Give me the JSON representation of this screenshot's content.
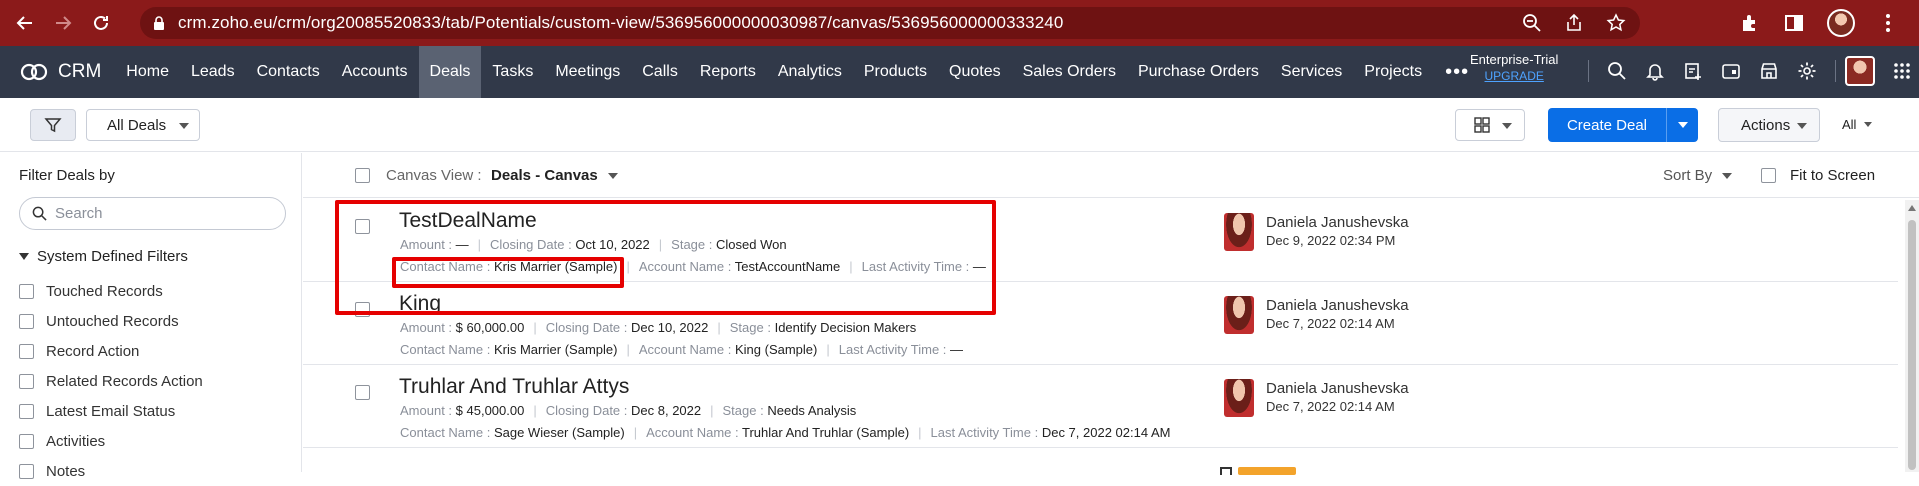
{
  "browser": {
    "url": "crm.zoho.eu/crm/org20085520833/tab/Potentials/custom-view/536956000000030987/canvas/536956000000333240"
  },
  "topnav": {
    "brand": "CRM",
    "tabs": [
      {
        "label": "Home"
      },
      {
        "label": "Leads"
      },
      {
        "label": "Contacts"
      },
      {
        "label": "Accounts"
      },
      {
        "label": "Deals",
        "active": true
      },
      {
        "label": "Tasks"
      },
      {
        "label": "Meetings"
      },
      {
        "label": "Calls"
      },
      {
        "label": "Reports"
      },
      {
        "label": "Analytics"
      },
      {
        "label": "Products"
      },
      {
        "label": "Quotes"
      },
      {
        "label": "Sales Orders"
      },
      {
        "label": "Purchase Orders"
      },
      {
        "label": "Services"
      },
      {
        "label": "Projects"
      }
    ],
    "more": "•••",
    "trial_label": "Enterprise-Trial",
    "upgrade_label": "UPGRADE"
  },
  "toolbar": {
    "view_name": "All Deals",
    "create_label": "Create Deal",
    "actions_label": "Actions",
    "all_label": "All"
  },
  "sidebar": {
    "title": "Filter Deals by",
    "search_placeholder": "Search",
    "section": "System Defined Filters",
    "items": [
      "Touched Records",
      "Untouched Records",
      "Record Action",
      "Related Records Action",
      "Latest Email Status",
      "Activities",
      "Notes"
    ]
  },
  "canvas": {
    "view_label": "Canvas View :",
    "view_value": "Deals - Canvas",
    "sort_label": "Sort By",
    "fit_label": "Fit to Screen"
  },
  "labels": {
    "amount": "Amount :",
    "closing": "Closing Date :",
    "stage": "Stage :",
    "contact": "Contact Name :",
    "account": "Account Name :",
    "last_activity": "Last Activity Time :"
  },
  "deals": [
    {
      "name": "TestDealName",
      "amount": "—",
      "closing_date": "Oct 10, 2022",
      "stage": "Closed Won",
      "contact": "Kris Marrier (Sample)",
      "account": "TestAccountName",
      "last_activity": "—",
      "owner": "Daniela Janushevska",
      "date": "Dec 9, 2022 02:34 PM"
    },
    {
      "name": "King",
      "amount": "$ 60,000.00",
      "closing_date": "Dec 10, 2022",
      "stage": "Identify Decision Makers",
      "contact": "Kris Marrier (Sample)",
      "account": "King (Sample)",
      "last_activity": "—",
      "owner": "Daniela Janushevska",
      "date": "Dec 7, 2022 02:14 AM"
    },
    {
      "name": "Truhlar And Truhlar Attys",
      "amount": "$ 45,000.00",
      "closing_date": "Dec 8, 2022",
      "stage": "Needs Analysis",
      "contact": "Sage Wieser (Sample)",
      "account": "Truhlar And Truhlar (Sample)",
      "last_activity": "Dec 7, 2022 02:14 AM",
      "owner": "Daniela Janushevska",
      "date": "Dec 7, 2022 02:14 AM"
    }
  ],
  "colors": {
    "browser_bar": "#8b1a1a",
    "nav_bg": "#313949",
    "primary": "#0a6ee6",
    "highlight": "#e50000"
  }
}
